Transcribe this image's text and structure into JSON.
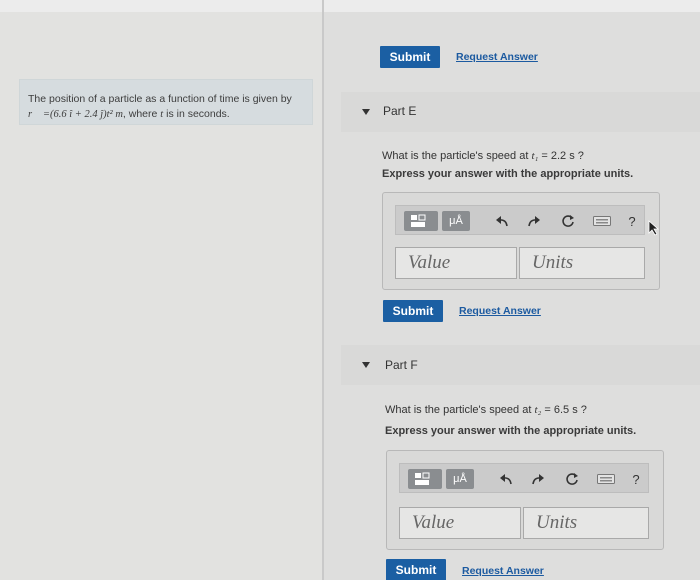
{
  "problem": {
    "line1": "The position of a particle as a function of time is given by",
    "line2_math": "r⃗ =(6.6 î + 2.4 ĵ)t² m",
    "line2_rest": ", where ",
    "line2_t": "t",
    "line2_end": " is in seconds."
  },
  "top": {
    "submit_label": "Submit",
    "request_label": "Request Answer"
  },
  "partE": {
    "label": "Part E",
    "question_pre": "What is the particle's speed at ",
    "question_math": "t₁",
    "question_post": " = 2.2 s ?",
    "instruction": "Express your answer with the appropriate units.",
    "value_placeholder": "Value",
    "units_placeholder": "Units",
    "submit_label": "Submit",
    "request_label": "Request Answer"
  },
  "partF": {
    "label": "Part F",
    "question_pre": "What is the particle's speed at ",
    "question_math": "t₂",
    "question_post": " = 6.5 s ?",
    "instruction": "Express your answer with the appropriate units.",
    "value_placeholder": "Value",
    "units_placeholder": "Units",
    "submit_label": "Submit",
    "request_label": "Request Answer"
  },
  "toolbar": {
    "mu_label": "μÅ",
    "help_label": "?",
    "icons": [
      "template-icon",
      "units-mu-icon",
      "undo-icon",
      "redo-icon",
      "reset-icon",
      "keyboard-icon",
      "help-icon"
    ]
  },
  "colors": {
    "submit_bg": "#1b5fa3",
    "link": "#1c5aa0",
    "problem_bg": "#d6dcdf"
  }
}
